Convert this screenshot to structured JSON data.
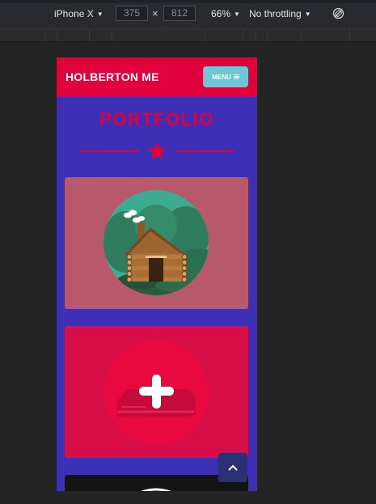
{
  "devtools": {
    "device_name": "iPhone X",
    "width_value": "375",
    "height_value": "812",
    "zoom": "66%",
    "throttling": "No throttling"
  },
  "site": {
    "brand": "HOLBERTON ME",
    "menu_label": "MENU",
    "section_title": "PORTFOLIO"
  },
  "colors": {
    "header": "#e0003c",
    "page_background": "#3d2fb6",
    "menu_button": "#6cc7d6",
    "card1": "#b8596b",
    "card2": "#d60d47"
  },
  "icons": {
    "star": "star-icon",
    "card1": "log-cabin-icon",
    "card2": "add-project-icon",
    "scroll_top": "chevron-up-icon"
  }
}
